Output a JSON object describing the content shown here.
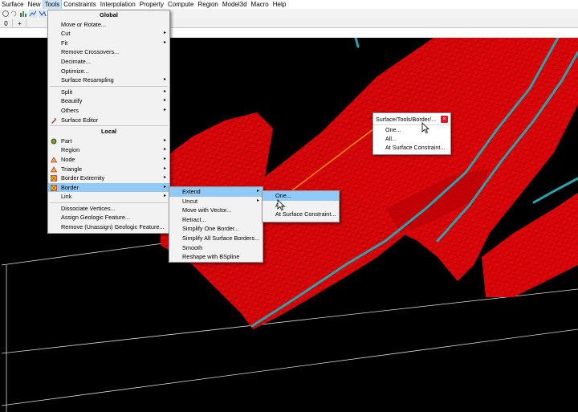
{
  "menubar": [
    "Surface",
    "New",
    "Tools",
    "Constraints",
    "Interpolation",
    "Property",
    "Compute",
    "Region",
    "Model3d",
    "Macro",
    "Help"
  ],
  "tabstrip": {
    "tab1": "0",
    "tab2": "+"
  },
  "tools_menu": {
    "global_header": "Global",
    "global_items": [
      {
        "label": "Move or Rotate...",
        "arrow": ""
      },
      {
        "label": "Cut",
        "arrow": "▸"
      },
      {
        "label": "Fit",
        "arrow": "▸"
      },
      {
        "label": "Remove Crossovers...",
        "arrow": ""
      },
      {
        "label": "Decimate...",
        "arrow": ""
      },
      {
        "label": "Optimize...",
        "arrow": ""
      },
      {
        "label": "Surface Resampling",
        "arrow": "▸"
      }
    ],
    "global_items2": [
      {
        "label": "Split",
        "arrow": "▸"
      },
      {
        "label": "Beautify",
        "arrow": "▸"
      },
      {
        "label": "Others",
        "arrow": "▸"
      },
      {
        "label": "Surface Editor",
        "arrow": ""
      }
    ],
    "local_header": "Local",
    "local_items": [
      {
        "label": "Part",
        "arrow": "▸"
      },
      {
        "label": "Region",
        "arrow": "▸"
      },
      {
        "label": "Node",
        "arrow": "▸"
      },
      {
        "label": "Triangle",
        "arrow": "▸"
      },
      {
        "label": "Border Extremity",
        "arrow": "▸"
      },
      {
        "label": "Border",
        "arrow": "▸"
      },
      {
        "label": "Link",
        "arrow": "▸"
      }
    ],
    "bottom_items": [
      {
        "label": "Dissociate Vertices...",
        "arrow": ""
      },
      {
        "label": "Assign Geologic Feature...",
        "arrow": ""
      },
      {
        "label": "Remove (Unassign) Geologic Feature...",
        "arrow": ""
      }
    ]
  },
  "border_menu": {
    "items": [
      {
        "label": "Extend",
        "arrow": "▸"
      },
      {
        "label": "Uncut",
        "arrow": "▸"
      },
      {
        "label": "Move with Vector...",
        "arrow": ""
      },
      {
        "label": "Retract...",
        "arrow": ""
      },
      {
        "label": "Simplify One Border...",
        "arrow": ""
      },
      {
        "label": "Simplify All Surface Borders...",
        "arrow": ""
      },
      {
        "label": "Smooth",
        "arrow": ""
      },
      {
        "label": "Reshape with BSpline",
        "arrow": ""
      }
    ]
  },
  "extend_menu": {
    "items": [
      "One...",
      "All...",
      "At Surface Constraint..."
    ]
  },
  "float_window": {
    "title": "Surface/Tools/Border/...",
    "close": "×",
    "items": [
      "One...",
      "All...",
      "At Surface Constraint..."
    ]
  },
  "colors": {
    "surface": "#e0060a",
    "border_line": "#2aa5ad",
    "connector": "#ff8c00",
    "menu_highlight": "#91c9f7"
  }
}
